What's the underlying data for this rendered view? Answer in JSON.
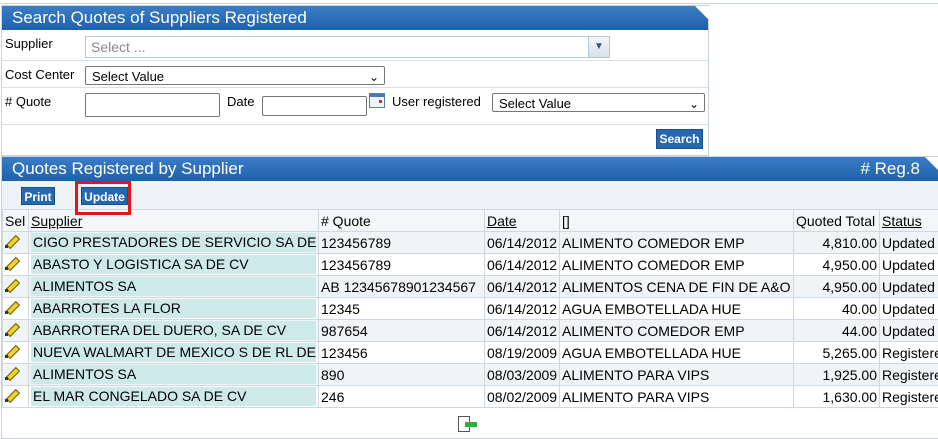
{
  "search_panel": {
    "title": "Search Quotes of Suppliers Registered",
    "supplier_label": "Supplier",
    "supplier_placeholder": "Select ...",
    "cost_center_label": "Cost Center",
    "cost_center_value": "Select Value",
    "quote_label": "# Quote",
    "date_label": "Date",
    "user_registered_label": "User registered",
    "user_registered_value": "Select Value",
    "search_button": "Search"
  },
  "results_panel": {
    "title": "Quotes Registered by Supplier",
    "reg_count": "# Reg.8",
    "print_button": "Print",
    "update_button": "Update",
    "columns": [
      "Sel",
      "Supplier",
      "# Quote",
      "Date",
      "[]",
      "Quoted Total",
      "Status"
    ],
    "rows": [
      {
        "supplier": "CIGO PRESTADORES DE SERVICIO SA DE CV",
        "quote": "123456789",
        "date": "06/14/2012",
        "desc": "ALIMENTO COMEDOR EMP",
        "total": "4,810.00",
        "status": "Updated"
      },
      {
        "supplier": "ABASTO Y LOGISTICA SA DE CV",
        "quote": "123456789",
        "date": "06/14/2012",
        "desc": "ALIMENTO COMEDOR EMP",
        "total": "4,950.00",
        "status": "Updated"
      },
      {
        "supplier": "ALIMENTOS SA",
        "quote": "AB 12345678901234567",
        "date": "06/14/2012",
        "desc": "ALIMENTOS CENA DE FIN DE A&O",
        "total": "4,950.00",
        "status": "Updated"
      },
      {
        "supplier": "ABARROTES LA FLOR",
        "quote": "12345",
        "date": "06/14/2012",
        "desc": "AGUA EMBOTELLADA HUE",
        "total": "40.00",
        "status": "Updated"
      },
      {
        "supplier": "ABARROTERA DEL DUERO, SA DE CV",
        "quote": "987654",
        "date": "06/14/2012",
        "desc": "ALIMENTO COMEDOR EMP",
        "total": "44.00",
        "status": "Updated"
      },
      {
        "supplier": "NUEVA WALMART DE MEXICO S DE RL DE CV",
        "quote": "123456",
        "date": "08/19/2009",
        "desc": "AGUA EMBOTELLADA HUE",
        "total": "5,265.00",
        "status": "Registered"
      },
      {
        "supplier": "ALIMENTOS SA",
        "quote": "890",
        "date": "08/03/2009",
        "desc": "ALIMENTO PARA VIPS",
        "total": "1,925.00",
        "status": "Registered"
      },
      {
        "supplier": "EL MAR CONGELADO SA DE CV",
        "quote": "246",
        "date": "08/02/2009",
        "desc": "ALIMENTO PARA VIPS",
        "total": "1,630.00",
        "status": "Registered"
      }
    ]
  },
  "colors": {
    "header_blue": "#2668b0",
    "supplier_highlight": "#cde9ea",
    "highlight_box": "#e01818"
  }
}
